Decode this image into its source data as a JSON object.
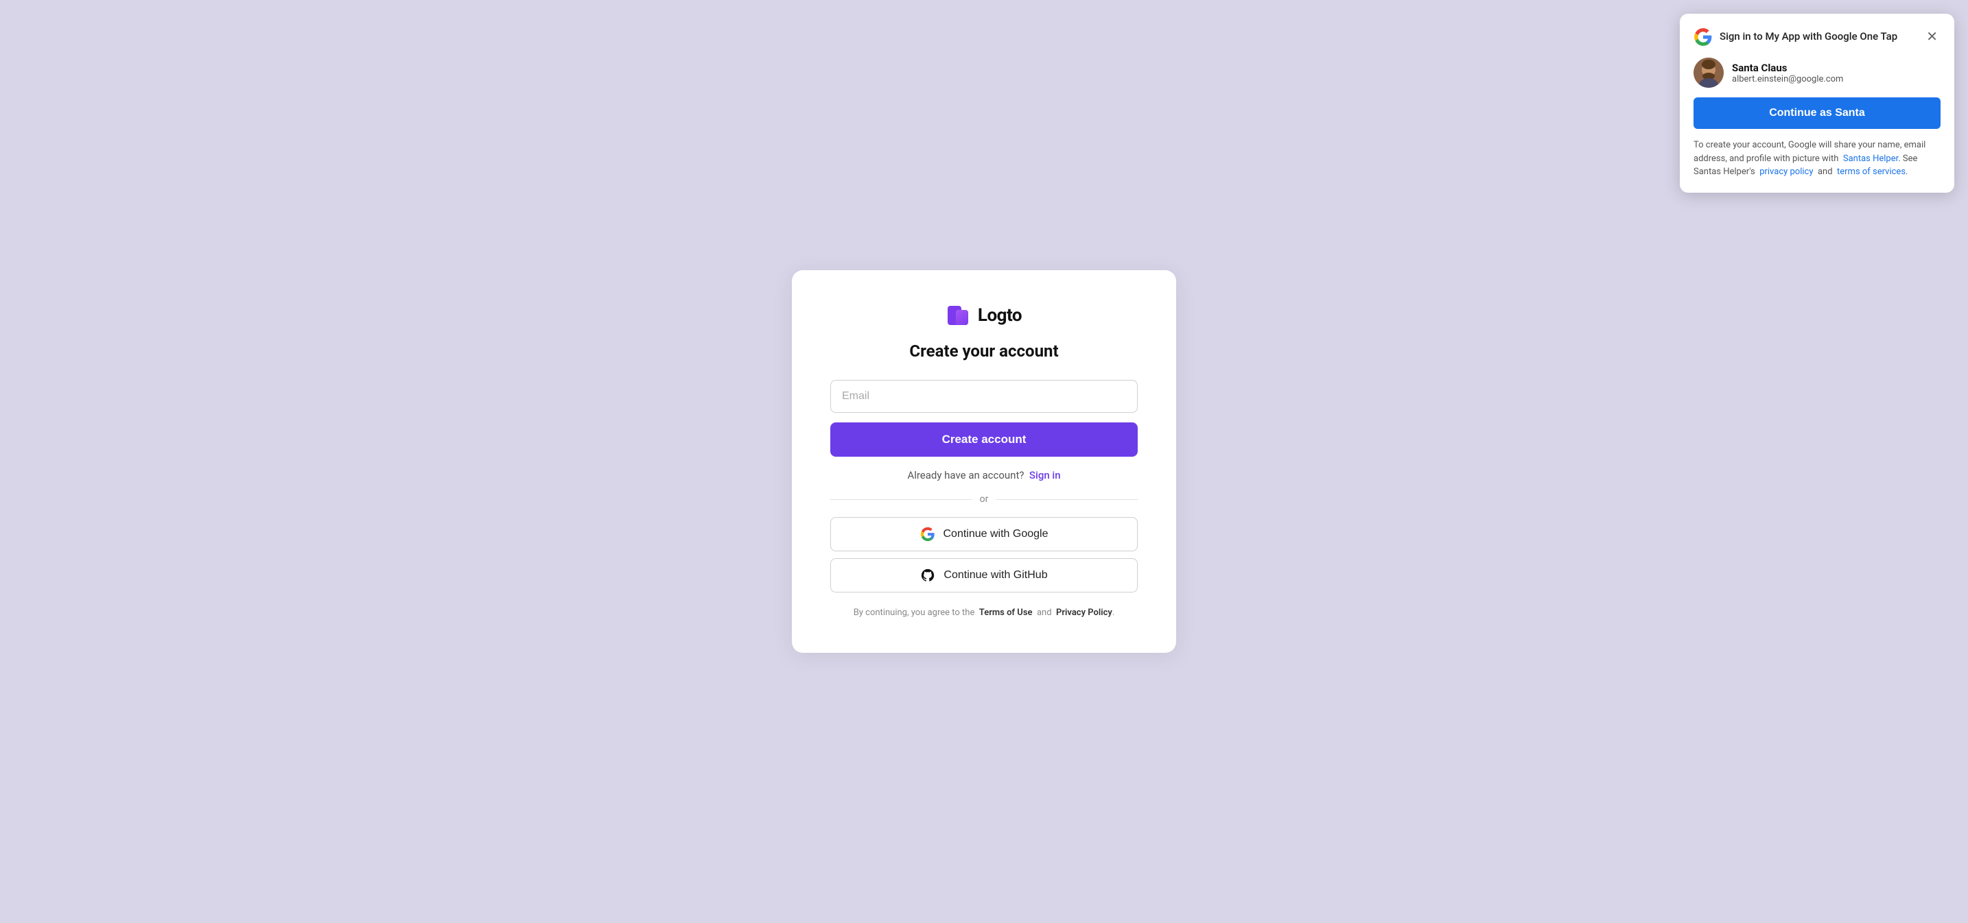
{
  "page": {
    "background_color": "#d8d5e8"
  },
  "logo": {
    "text": "Logto"
  },
  "card": {
    "title": "Create your account",
    "email_placeholder": "Email",
    "create_button_label": "Create account",
    "signin_text": "Already have an account?",
    "signin_link_label": "Sign in",
    "divider_text": "or",
    "google_button_label": "Continue with Google",
    "github_button_label": "Continue with GitHub",
    "terms_prefix": "By continuing, you agree to the",
    "terms_label": "Terms of Use",
    "terms_connector": "and",
    "privacy_label": "Privacy Policy",
    "terms_suffix": "."
  },
  "one_tap": {
    "title": "Sign in to My App with Google One Tap",
    "user_name": "Santa Claus",
    "user_email": "albert.einstein@google.com",
    "continue_button_label": "Continue as Santa",
    "footer_text": "To create your account, Google will share your name, email address, and profile with picture with",
    "app_name": "Santas Helper",
    "footer_text2": ". See Santas Helper's",
    "privacy_link_label": "privacy policy",
    "footer_connector": "and",
    "tos_link_label": "terms of services",
    "footer_end": "."
  },
  "icons": {
    "close": "✕",
    "google_g": "G",
    "github": "github"
  }
}
